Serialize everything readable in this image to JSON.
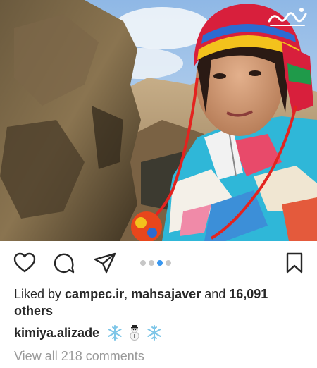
{
  "post": {
    "watermark_text": "رویا",
    "likes": {
      "prefix": "Liked by ",
      "user1": "campec.ir",
      "separator": ", ",
      "user2": "mahsajaver",
      "middle": " and ",
      "count": "16,091",
      "suffix": " others"
    },
    "caption": {
      "username": "kimiya.alizade",
      "emojis": [
        "snowflake-icon",
        "snowman-icon",
        "snowflake-icon"
      ]
    },
    "view_comments": "View all 218 comments",
    "carousel": {
      "total": 4,
      "active_index": 2
    },
    "accent_color": "#3897f0",
    "icons": [
      "heart-icon",
      "comment-bubble-icon",
      "send-icon",
      "bookmark-icon"
    ]
  }
}
